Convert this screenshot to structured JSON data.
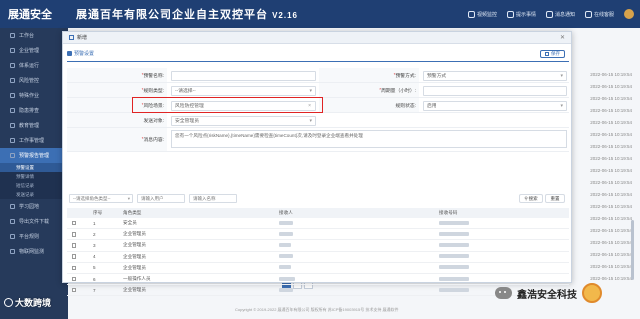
{
  "app": {
    "logo": "展通安全",
    "title": "展通百年有限公司企业自主双控平台",
    "version": "V2.16",
    "nav": [
      "视频监控",
      "提示事情",
      "消息通知",
      "在线客服"
    ]
  },
  "sidebar": {
    "items": [
      {
        "label": "工作台"
      },
      {
        "label": "企业管理"
      },
      {
        "label": "体系运行"
      },
      {
        "label": "风险管控"
      },
      {
        "label": "特殊作业"
      },
      {
        "label": "隐患排查"
      },
      {
        "label": "教育管理"
      },
      {
        "label": "工作事管理"
      },
      {
        "label": "预警报告管理",
        "active": true
      }
    ],
    "subitems": [
      {
        "label": "预警设置",
        "current": true
      },
      {
        "label": "预警详情"
      },
      {
        "label": "短信记录"
      },
      {
        "label": "发送记录"
      }
    ],
    "items_bottom": [
      {
        "label": "学习园地"
      },
      {
        "label": "导出文件下载"
      },
      {
        "label": "平台规则"
      },
      {
        "label": "物联网监测"
      }
    ]
  },
  "background": {
    "times": [
      "2022-06-15 10:19:54",
      "2022-06-15 10:19:54",
      "2022-06-15 10:19:54",
      "2022-06-15 10:19:54",
      "2022-06-15 10:19:54",
      "2022-06-15 10:19:54",
      "2022-06-15 10:19:54",
      "2022-06-15 10:19:54",
      "2022-06-15 10:19:54",
      "2022-06-15 10:19:54",
      "2022-06-15 10:19:54",
      "2022-06-15 10:19:54",
      "2022-06-15 10:19:54",
      "2022-06-15 10:19:54",
      "2022-06-15 10:19:54",
      "2022-06-15 10:19:54",
      "2022-06-15 10:19:54",
      "2022-06-15 10:19:54"
    ],
    "footer": "Copyright © 2019-2022 展通百年有限公司 版权所有 苏ICP备19003915号 技术支持 展通软件"
  },
  "modal": {
    "title": "新增",
    "section_title": "预警设置",
    "save_label": "保存",
    "fields": {
      "warning_name_label": "预警名称:",
      "warning_name_value": "",
      "warning_method_label": "预警方式:",
      "warning_method_value": "预警方式",
      "rule_type_label": "规则类型:",
      "rule_type_value": "--请选择--",
      "cycle_label": "周期量（小时）:",
      "cycle_value": "",
      "scenario_label": "风险场景:",
      "scenario_value": "风险防控管理",
      "rule_status_label": "规则状态:",
      "rule_status_value": "启用",
      "send_target_label": "发送对象:",
      "send_target_value": "安全管理员",
      "content_label": "消息内容:",
      "content_value": "您有一个风险点{riskName},{timeName}需要检查{timeCount}次,请及时登录企业端查看并处理"
    },
    "filter": {
      "role_type_placeholder": "--请选择角色类型--",
      "user_placeholder": "请输入用户",
      "name_placeholder": "请输入名称",
      "search_label": "搜索",
      "reset_label": "重置"
    },
    "table": {
      "columns": [
        "序号",
        "角色类型",
        "接收人",
        "接收号码"
      ],
      "rows": [
        {
          "no": "1",
          "role": "安全员"
        },
        {
          "no": "2",
          "role": "企业管理员"
        },
        {
          "no": "3",
          "role": "企业管理员"
        },
        {
          "no": "4",
          "role": "企业管理员"
        },
        {
          "no": "5",
          "role": "企业管理员"
        },
        {
          "no": "6",
          "role": "一般操作人员"
        },
        {
          "no": "7",
          "role": "企业管理员"
        }
      ]
    }
  },
  "watermarks": {
    "left": "大数跨境",
    "right": "鑫浩安全科技"
  }
}
